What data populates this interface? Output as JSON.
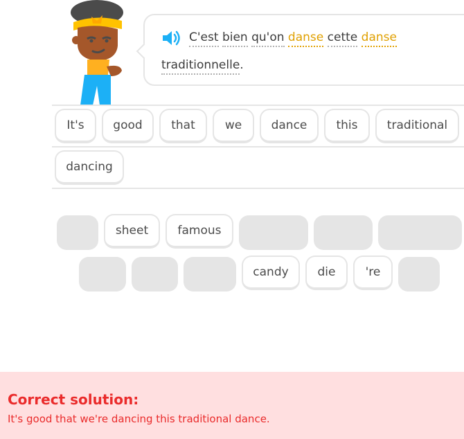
{
  "prompt": {
    "line1": [
      {
        "text": "C'est",
        "highlight": false
      },
      {
        "text": " ",
        "space": true
      },
      {
        "text": "bien",
        "highlight": false
      },
      {
        "text": " ",
        "space": true
      },
      {
        "text": "qu'on",
        "highlight": false
      },
      {
        "text": " ",
        "space": true
      },
      {
        "text": "danse",
        "highlight": true
      },
      {
        "text": " ",
        "space": true
      },
      {
        "text": "cette",
        "highlight": false
      },
      {
        "text": " ",
        "space": true
      },
      {
        "text": "danse",
        "highlight": true
      }
    ],
    "line2": "traditionnelle",
    "line2_punct": ".",
    "speaker_icon": "speaker-icon"
  },
  "answer": {
    "words": [
      "It's",
      "good",
      "that",
      "we",
      "dance",
      "this",
      "traditional",
      "dancing"
    ]
  },
  "bank": {
    "words": [
      "sheet",
      "famous",
      "candy",
      "die",
      "'re"
    ]
  },
  "footer": {
    "title": "Correct solution:",
    "solution": "It's good that we're dancing this traditional dance."
  },
  "colors": {
    "highlight": "#e0a000",
    "error_bg": "#ffdfe0",
    "error_text": "#ea2b2b",
    "speaker": "#1cb0f6"
  }
}
